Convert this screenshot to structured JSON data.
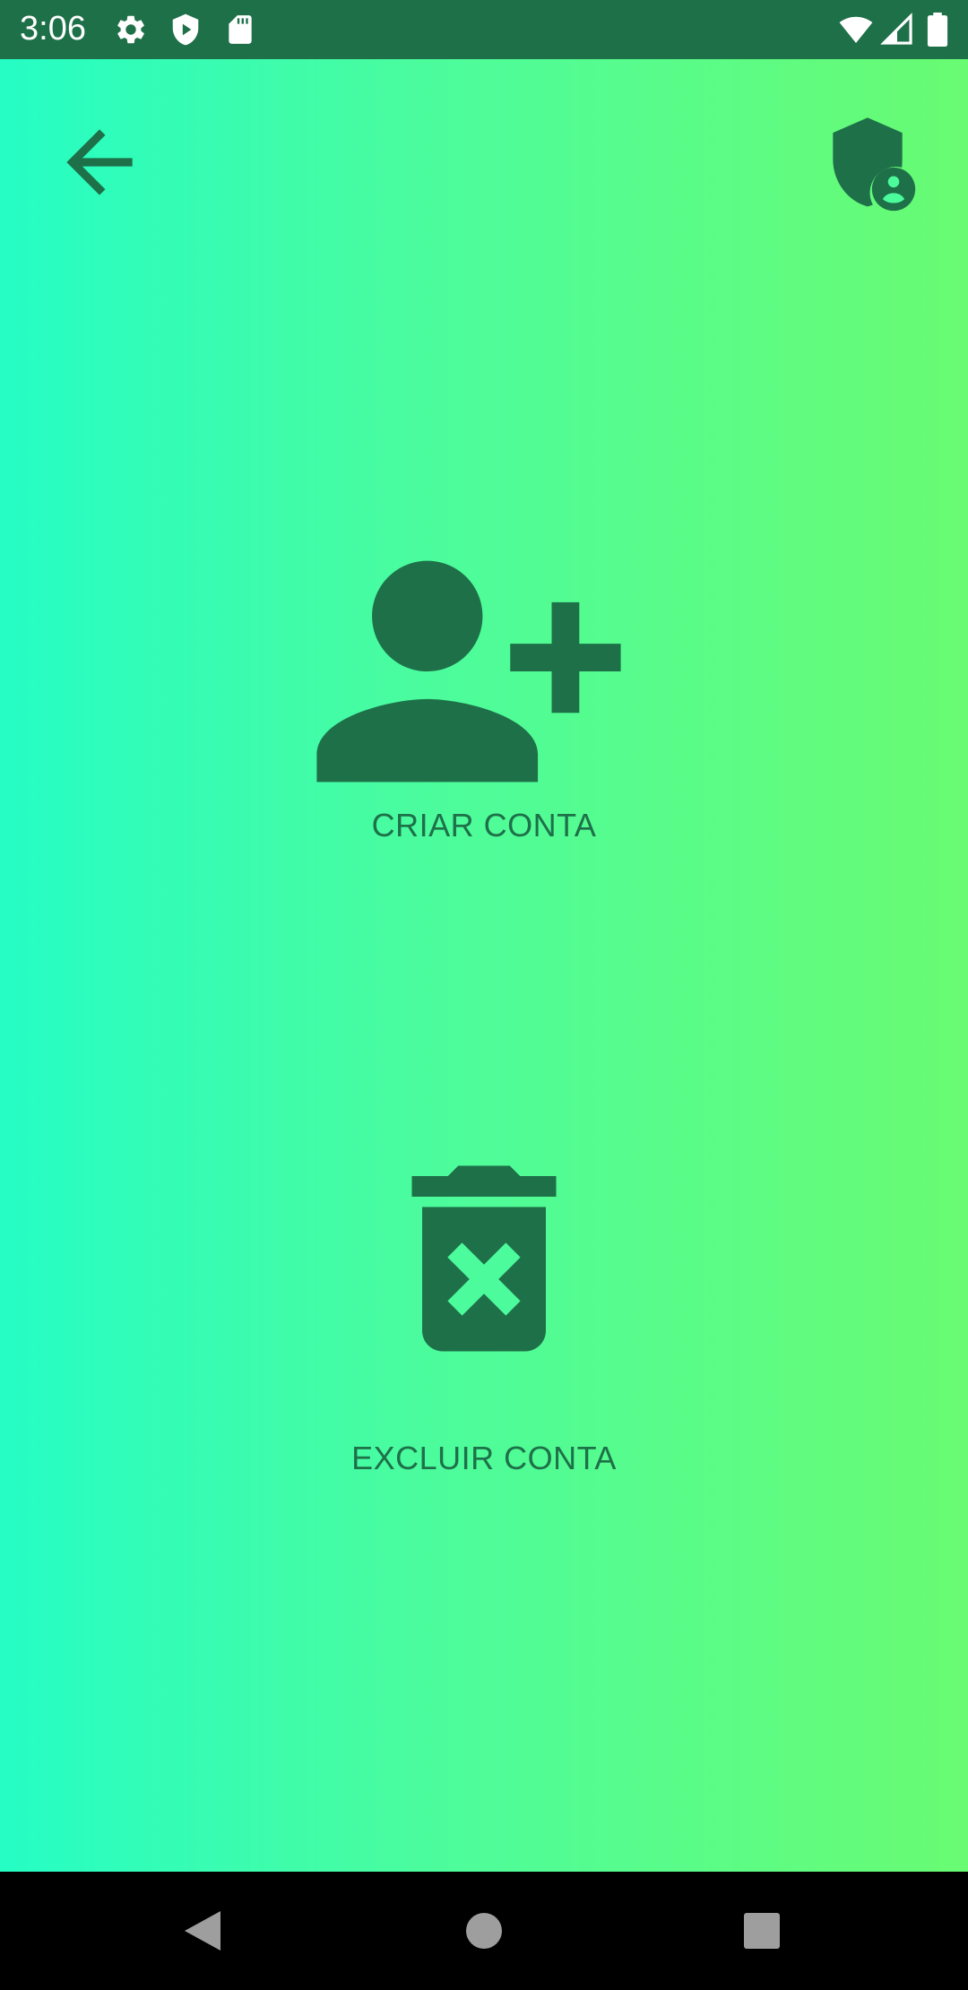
{
  "status_bar": {
    "time": "3:06",
    "icons": [
      "gear-icon",
      "play-shield-icon",
      "sd-card-icon",
      "wifi-icon",
      "signal-icon",
      "battery-icon"
    ]
  },
  "toolbar": {
    "back_icon": "arrow-back-icon",
    "account_icon": "admin-shield-person-icon"
  },
  "actions": [
    {
      "icon": "person-add-icon",
      "label": "CRIAR CONTA"
    },
    {
      "icon": "delete-forever-icon",
      "label": "EXCLUIR CONTA"
    }
  ],
  "nav_bar": {
    "buttons": [
      "back-triangle-icon",
      "home-circle-icon",
      "recents-square-icon"
    ]
  },
  "colors": {
    "primary_dark": "#1e7049",
    "gradient_start": "#25fdc5",
    "gradient_end": "#69fb72",
    "nav_background": "#000000"
  }
}
